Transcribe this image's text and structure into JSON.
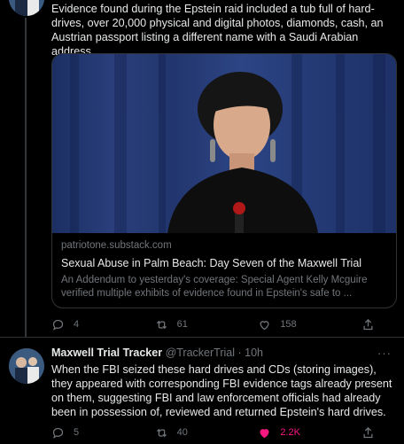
{
  "tweet1": {
    "text": "Evidence found during the Epstein raid included a tub full of hard-drives, over 20,000 physical and digital photos, diamonds, cash, an Austrian passport listing a different name with a Saudi Arabian address.",
    "card": {
      "domain": "patriotone.substack.com",
      "title": "Sexual Abuse in Palm Beach: Day Seven of the Maxwell Trial",
      "description": "An Addendum to yesterday's coverage: Special Agent Kelly Mcguire verified multiple exhibits of evidence found in Epstein's safe to ..."
    },
    "actions": {
      "replies": "4",
      "retweets": "61",
      "likes": "158"
    }
  },
  "tweet2": {
    "name": "Maxwell Trial Tracker",
    "handle": "@TrackerTrial",
    "separator": "·",
    "time": "10h",
    "more": "···",
    "text": "When the FBI seized these hard drives and CDs (storing images), they appeared with corresponding FBI evidence tags already present on them, suggesting FBI and law enforcement officials had already been in possession of, reviewed and returned Epstein's hard drives.",
    "actions": {
      "replies": "5",
      "retweets": "40",
      "likes": "2.2K"
    }
  },
  "colors": {
    "background": "#000000",
    "text": "#e7e9ea",
    "muted": "#71767b",
    "like": "#f91880"
  }
}
